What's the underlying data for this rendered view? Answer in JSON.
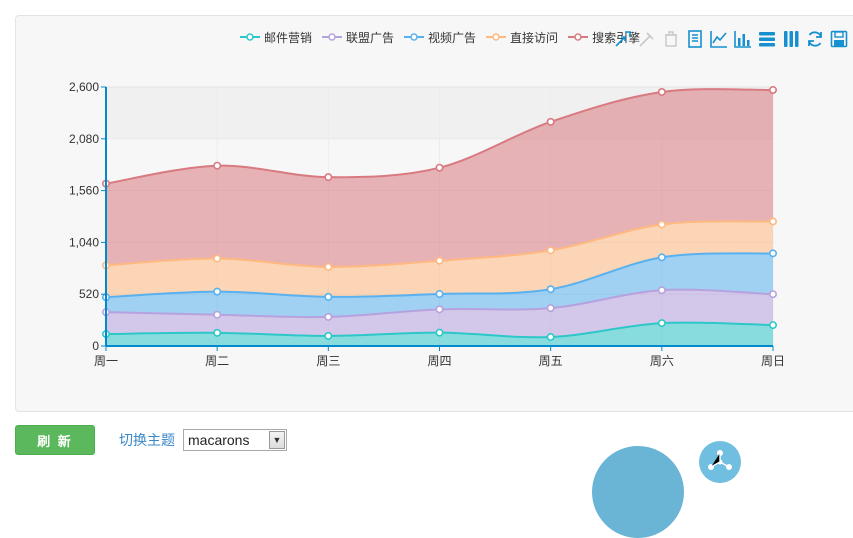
{
  "chart_data": {
    "type": "area",
    "stacked": true,
    "categories": [
      "周一",
      "周二",
      "周三",
      "周四",
      "周五",
      "周六",
      "周日"
    ],
    "series": [
      {
        "name": "邮件营销",
        "color": "#2ec7c9",
        "values": [
          120,
          132,
          101,
          134,
          90,
          230,
          210
        ]
      },
      {
        "name": "联盟广告",
        "color": "#b6a2de",
        "values": [
          220,
          182,
          191,
          234,
          290,
          330,
          310
        ]
      },
      {
        "name": "视频广告",
        "color": "#5ab1ef",
        "values": [
          150,
          232,
          201,
          154,
          190,
          330,
          410
        ]
      },
      {
        "name": "直接访问",
        "color": "#ffb980",
        "values": [
          320,
          332,
          301,
          334,
          390,
          330,
          320
        ]
      },
      {
        "name": "搜索引擎",
        "color": "#d87a80",
        "values": [
          820,
          932,
          901,
          934,
          1290,
          1330,
          1320
        ]
      }
    ],
    "yticks": [
      "0",
      "520",
      "1,040",
      "1,560",
      "2,080",
      "2,600"
    ],
    "ylim": [
      0,
      2600
    ],
    "legend_position": "top-right"
  },
  "toolbox": {
    "icons": [
      "zoom-icon",
      "zoom-reset-icon",
      "restore-icon",
      "data-view-icon",
      "line-chart-icon",
      "bar-chart-icon",
      "stack-icon",
      "tiled-icon",
      "refresh-icon",
      "save-image-icon"
    ]
  },
  "controls": {
    "refresh_label": "刷 新",
    "theme_label": "切换主题",
    "theme_value": "macarons"
  }
}
